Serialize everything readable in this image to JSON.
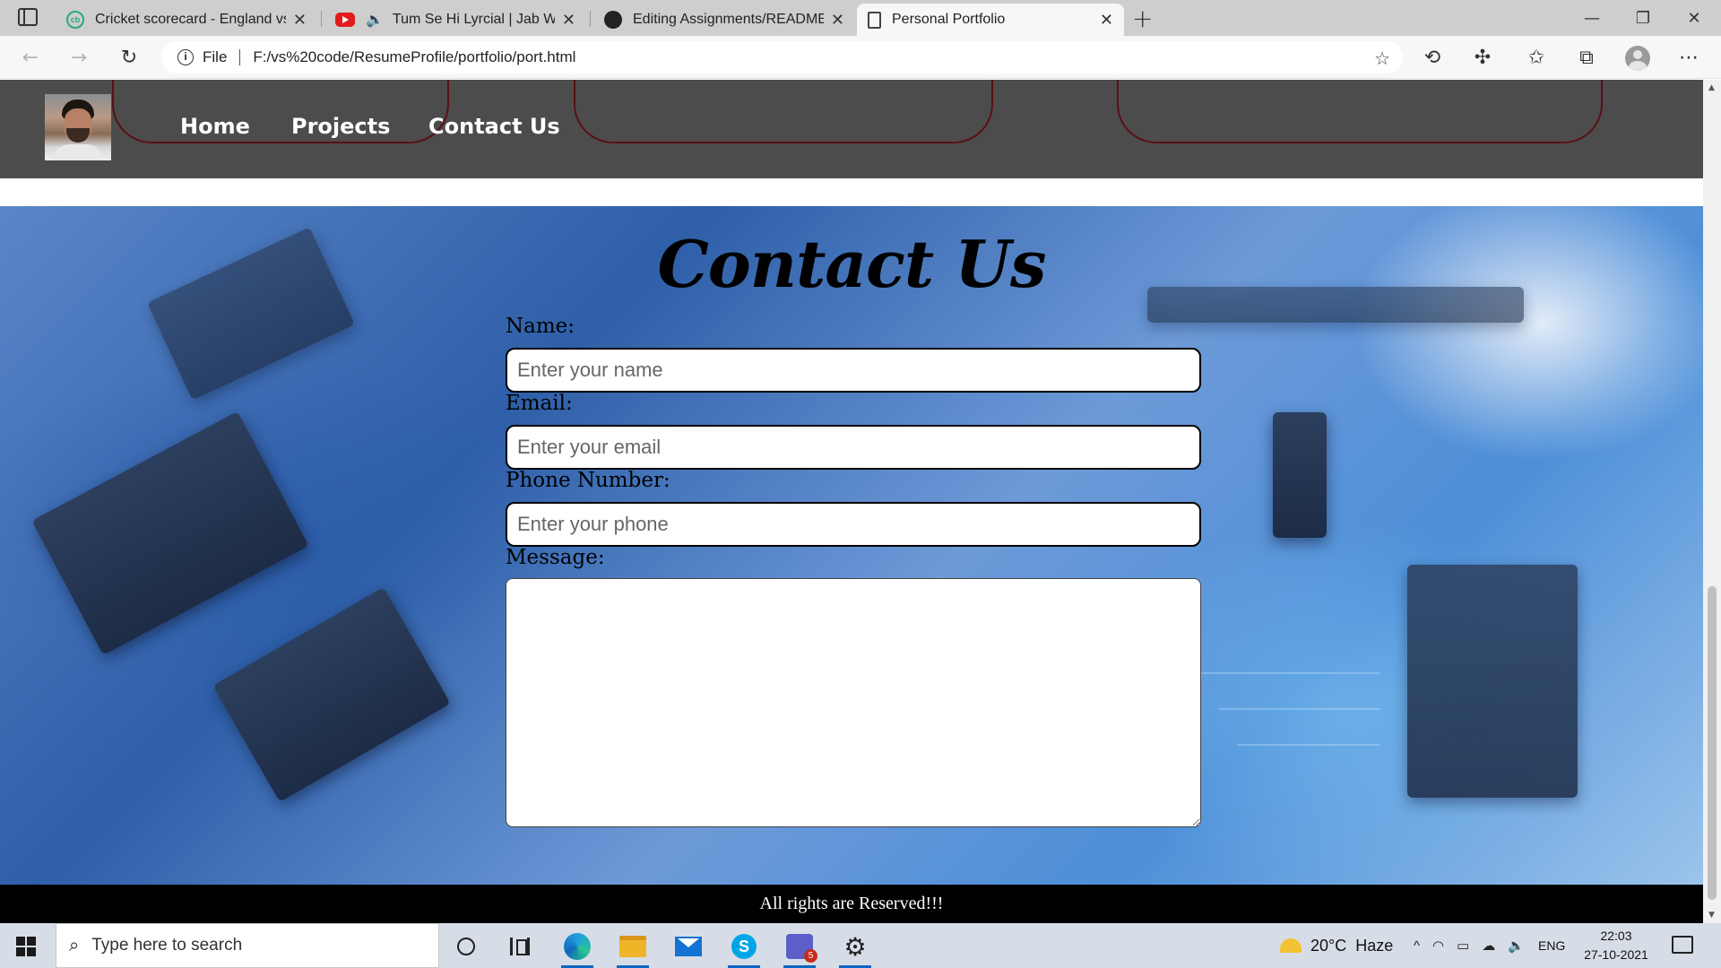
{
  "browser": {
    "tabs": [
      {
        "title": "Cricket scorecard - England vs Ba",
        "favicon": "cricbuzz-icon",
        "active": false
      },
      {
        "title": "Tum Se Hi Lyrcial | Jab We Me",
        "favicon": "youtube-icon",
        "audio": true,
        "active": false
      },
      {
        "title": "Editing Assignments/README.m",
        "favicon": "github-icon",
        "active": false
      },
      {
        "title": "Personal Portfolio",
        "favicon": "page-icon",
        "active": true
      }
    ],
    "address": {
      "scheme_label": "File",
      "url": "F:/vs%20code/ResumeProfile/portfolio/port.html"
    }
  },
  "page": {
    "nav": {
      "links": [
        "Home",
        "Projects",
        "Contact Us"
      ]
    },
    "contact": {
      "heading": "Contact Us",
      "fields": [
        {
          "label": "Name:",
          "placeholder": "Enter your name",
          "value": ""
        },
        {
          "label": "Email:",
          "placeholder": "Enter your email",
          "value": ""
        },
        {
          "label": "Phone Number:",
          "placeholder": "Enter your phone",
          "value": ""
        }
      ],
      "message_label": "Message:",
      "message_value": ""
    },
    "footer": "All rights are Reserved!!!"
  },
  "taskbar": {
    "search_placeholder": "Type here to search",
    "apps": [
      "cortana-icon",
      "task-view-icon",
      "edge-icon",
      "file-explorer-icon",
      "mail-icon",
      "skype-icon",
      "teams-icon",
      "settings-icon"
    ],
    "teams_badge": "5",
    "weather": {
      "temp": "20°C",
      "condition": "Haze"
    },
    "language": "ENG",
    "time": "22:03",
    "date": "27-10-2021"
  }
}
